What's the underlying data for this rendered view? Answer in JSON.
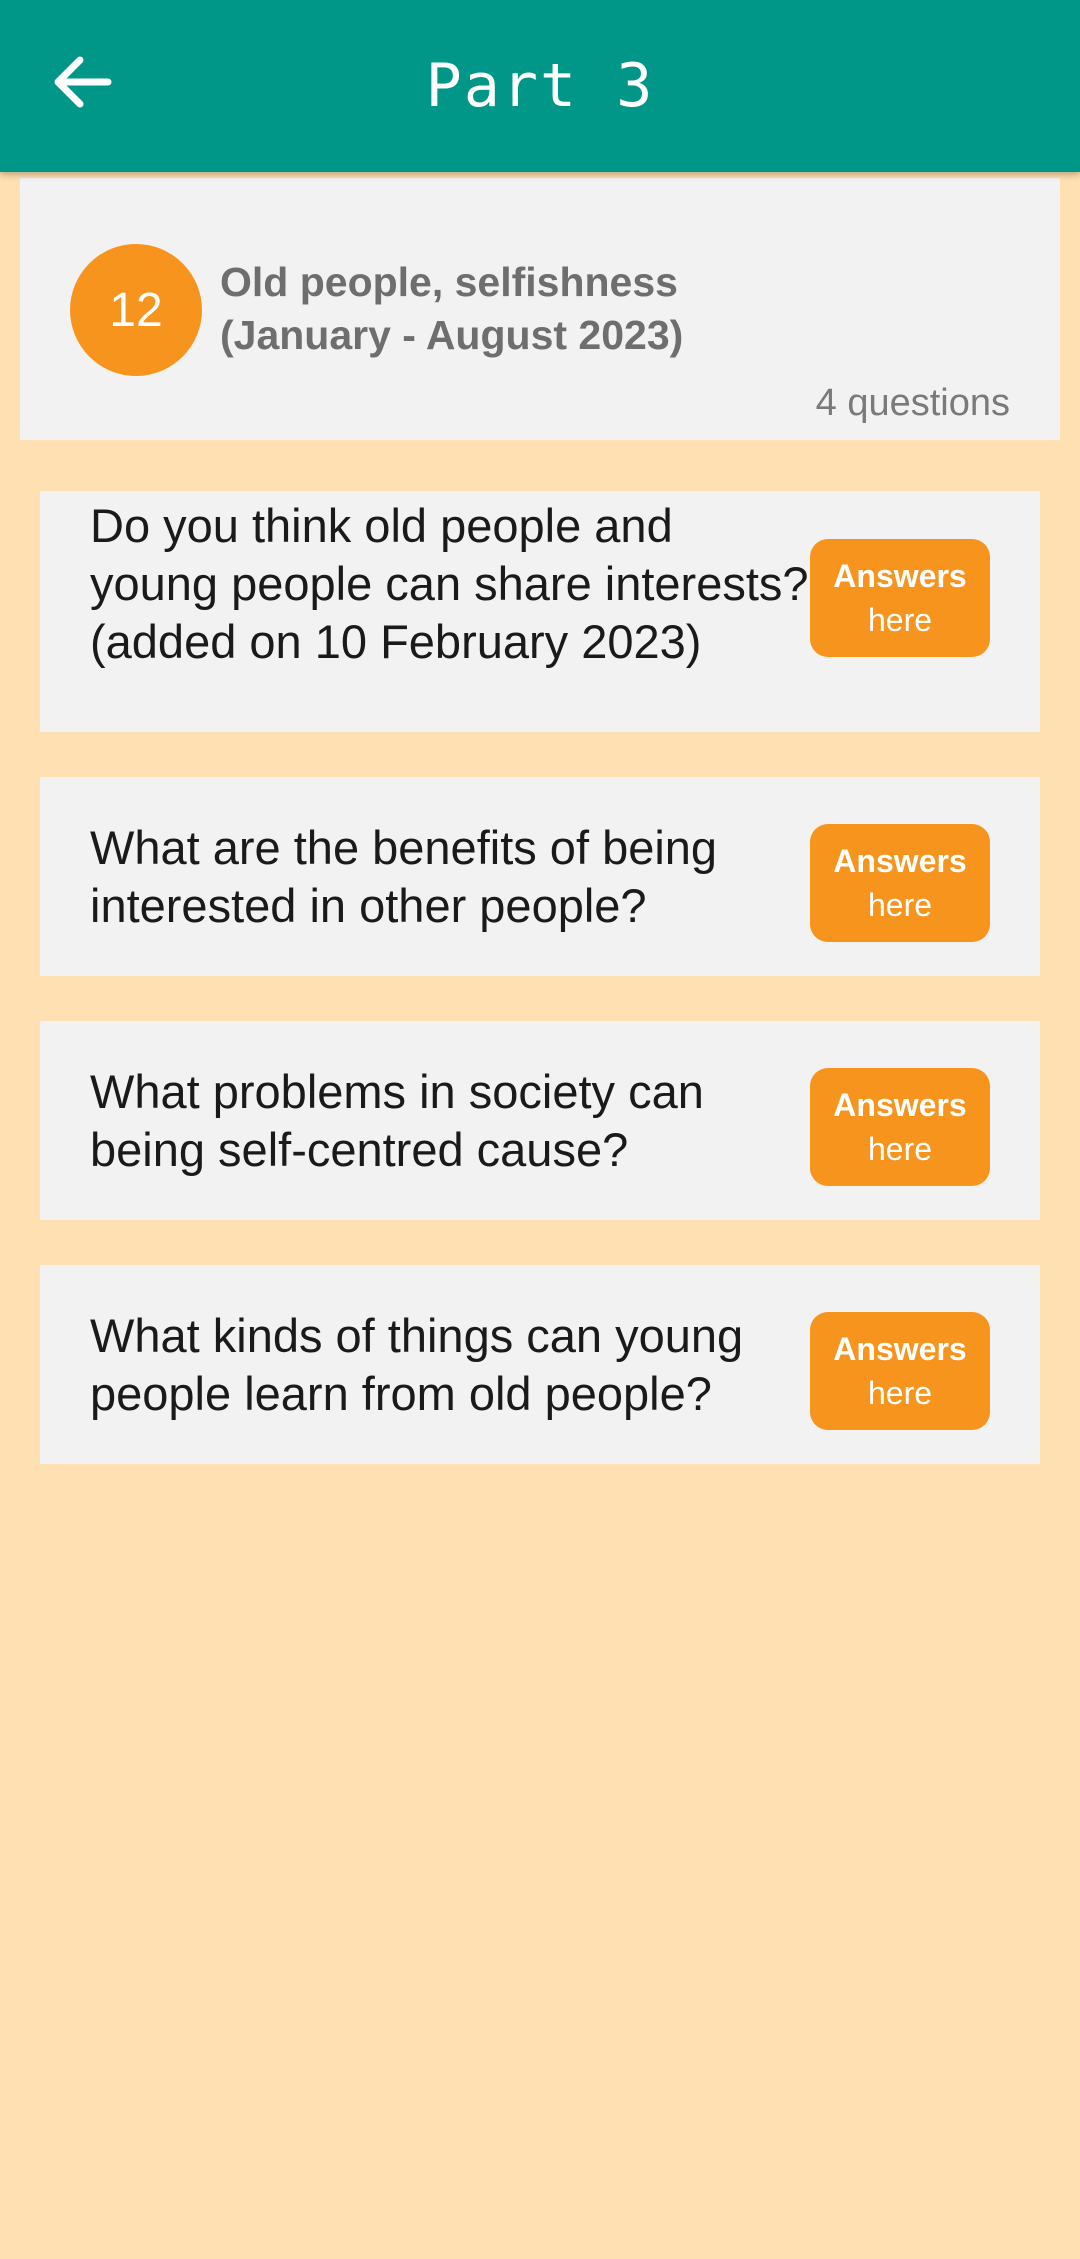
{
  "app_bar": {
    "title": "Part 3",
    "back_icon": "arrow-left-icon",
    "background": "#009688"
  },
  "topic": {
    "number": "12",
    "title": "Old people, selfishness\n(January - August 2023)",
    "count_label": "4 questions",
    "badge_color": "#F7941D"
  },
  "questions": [
    {
      "text": "Do you think old people and young people can share interests? (added on 10 February 2023)",
      "button_line1": "Answers",
      "button_line2": "here"
    },
    {
      "text": "What are the benefits of being interested in other people?",
      "button_line1": "Answers",
      "button_line2": "here"
    },
    {
      "text": "What problems in society can being self-centred cause?",
      "button_line1": "Answers",
      "button_line2": "here"
    },
    {
      "text": "What kinds of things can young people learn from old people?",
      "button_line1": "Answers",
      "button_line2": "here"
    }
  ],
  "colors": {
    "page_background": "#FFE0B2",
    "card_background": "#F2F2F2",
    "accent": "#F7941D"
  }
}
